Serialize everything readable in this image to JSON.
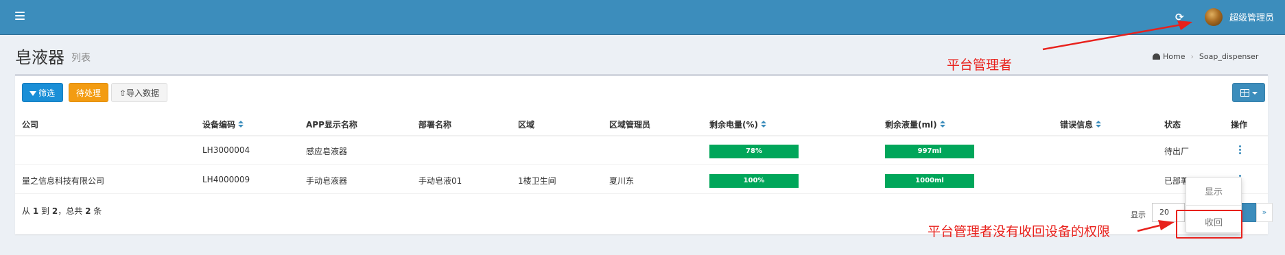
{
  "header": {
    "menu_icon": "hamburger-icon",
    "refresh_icon": "refresh-icon",
    "refresh_glyph": "⟳",
    "username": "超级管理员"
  },
  "page": {
    "title": "皂液器",
    "subtitle": "列表",
    "breadcrumb": [
      "Home",
      "Soap_dispenser"
    ]
  },
  "toolbar": {
    "filter_label": "筛选",
    "pending_label": "待处理",
    "import_label": "⇧导入数据"
  },
  "table": {
    "columns": [
      "公司",
      "设备编码",
      "APP显示名称",
      "部署名称",
      "区域",
      "区域管理员",
      "剩余电量(%)",
      "剩余液量(ml)",
      "错误信息",
      "状态",
      "操作"
    ],
    "rows": [
      {
        "company": "",
        "code": "LH3000004",
        "app_name": "感应皂液器",
        "deploy_name": "",
        "area": "",
        "area_admin": "",
        "battery": "78%",
        "liquid": "997ml",
        "error": "",
        "status": "待出厂"
      },
      {
        "company": "量之信息科技有限公司",
        "code": "LH4000009",
        "app_name": "手动皂液器",
        "deploy_name": "手动皂液01",
        "area": "1楼卫生间",
        "area_admin": "夏川东",
        "battery": "100%",
        "liquid": "1000ml",
        "error": "",
        "status": "已部署"
      }
    ]
  },
  "footer": {
    "summary_prefix": "从",
    "summary_from": "1",
    "summary_to_word": "到",
    "summary_to": "2",
    "summary_total_word": "，总共",
    "summary_total": "2",
    "summary_suffix": "条",
    "show_label": "显示",
    "page_size": "20",
    "next_label": "»"
  },
  "dropdown": {
    "show_label": "显示",
    "recall_label": "收回"
  },
  "annotations": {
    "admin_note": "平台管理者",
    "permission_note": "平台管理者没有收回设备的权限"
  },
  "colors": {
    "header": "#3c8dbc",
    "progress": "#00a65a",
    "annotation": "#e8211c",
    "pending_button": "#f39c12",
    "filter_button": "#1a8fd7"
  }
}
